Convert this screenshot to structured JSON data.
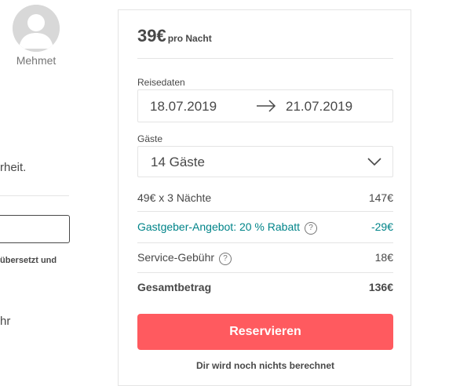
{
  "host": {
    "name": "Mehmet"
  },
  "left_fragments": {
    "line1": "rheit.",
    "line2": "übersetzt und",
    "line3": "hr"
  },
  "booking": {
    "price": "39€",
    "price_unit": "pro Nacht",
    "dates_label": "Reisedaten",
    "check_in": "18.07.2019",
    "check_out": "21.07.2019",
    "guests_label": "Gäste",
    "guests_value": "14 Gäste",
    "breakdown": {
      "nights_label": "49€ x 3 Nächte",
      "nights_value": "147€",
      "discount_label": "Gastgeber-Angebot: 20 % Rabatt",
      "discount_value": "-29€",
      "service_label": "Service-Gebühr",
      "service_value": "18€",
      "total_label": "Gesamtbetrag",
      "total_value": "136€"
    },
    "reserve_label": "Reservieren",
    "note": "Dir wird noch nichts berechnet"
  },
  "colors": {
    "accent": "#ff5a5f",
    "teal": "#008489",
    "text": "#484848"
  },
  "icons": {
    "avatar": "user-silhouette-icon",
    "arrow": "arrow-right-icon",
    "chevron": "chevron-down-icon",
    "help": "question-circle-icon"
  }
}
